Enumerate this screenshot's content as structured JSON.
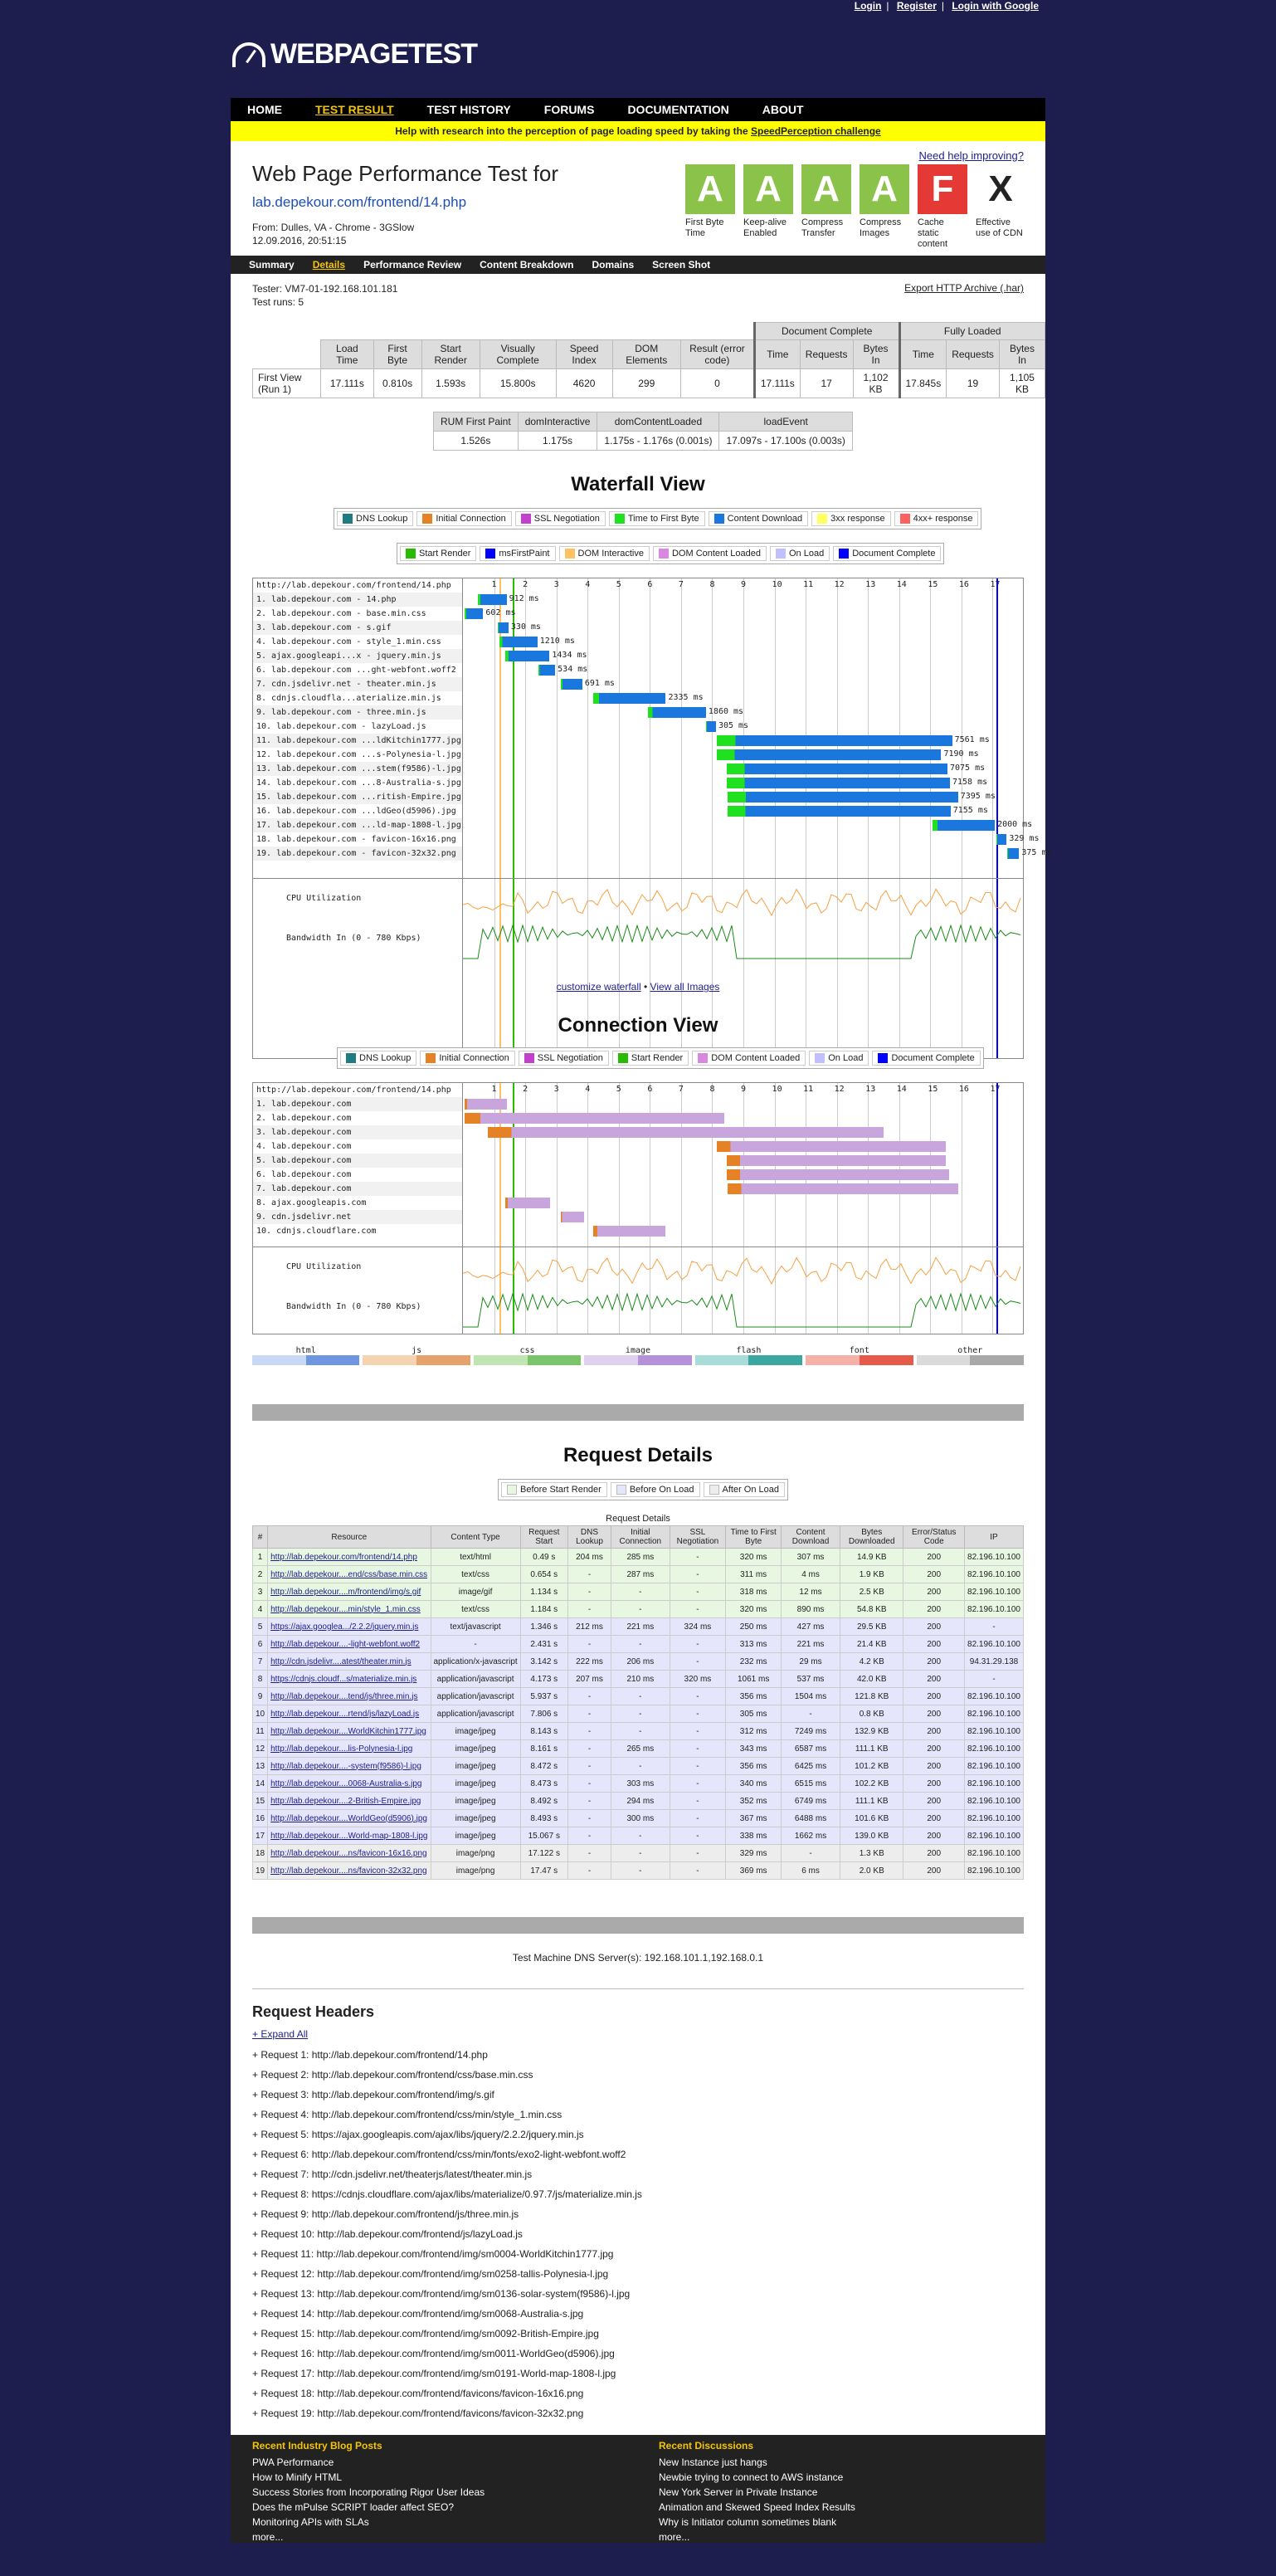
{
  "toplinks": {
    "login": "Login",
    "register": "Register",
    "google": "Login with Google"
  },
  "logo": "WEBPAGETEST",
  "nav": [
    "HOME",
    "TEST RESULT",
    "TEST HISTORY",
    "FORUMS",
    "DOCUMENTATION",
    "ABOUT"
  ],
  "banner": {
    "text": "Help with research into the perception of page loading speed by taking the",
    "link": "SpeedPerception challenge"
  },
  "help": "Need help improving?",
  "title": "Web Page Performance Test for",
  "url": "lab.depekour.com/frontend/14.php",
  "meta": {
    "from": "From: Dulles, VA - Chrome - 3GSlow",
    "date": "12.09.2016, 20:51:15"
  },
  "grades": [
    {
      "letter": "A",
      "label": "First Byte Time",
      "color": "#8bc34a"
    },
    {
      "letter": "A",
      "label": "Keep-alive Enabled",
      "color": "#8bc34a"
    },
    {
      "letter": "A",
      "label": "Compress Transfer",
      "color": "#8bc34a"
    },
    {
      "letter": "A",
      "label": "Compress Images",
      "color": "#8bc34a"
    },
    {
      "letter": "F",
      "label": "Cache static content",
      "color": "#e53935"
    },
    {
      "letter": "X",
      "label": "Effective use of CDN",
      "color": "#ffffff"
    }
  ],
  "subnav": [
    "Summary",
    "Details",
    "Performance Review",
    "Content Breakdown",
    "Domains",
    "Screen Shot"
  ],
  "tester": {
    "line1": "Tester: VM7-01-192.168.101.181",
    "line2": "Test runs: 5"
  },
  "har": "Export HTTP Archive (.har)",
  "summary": {
    "group_doc": "Document Complete",
    "group_full": "Fully Loaded",
    "headers": [
      "Load Time",
      "First Byte",
      "Start Render",
      "Visually Complete",
      "Speed Index",
      "DOM Elements",
      "Result (error code)",
      "Time",
      "Requests",
      "Bytes In",
      "Time",
      "Requests",
      "Bytes In"
    ],
    "rowlabel": "First View (Run 1)",
    "values": [
      "17.111s",
      "0.810s",
      "1.593s",
      "15.800s",
      "4620",
      "299",
      "0",
      "17.111s",
      "17",
      "1,102 KB",
      "17.845s",
      "19",
      "1,105 KB"
    ]
  },
  "rum": {
    "headers": [
      "RUM First Paint",
      "domInteractive",
      "domContentLoaded",
      "loadEvent"
    ],
    "values": [
      "1.526s",
      "1.175s",
      "1.175s - 1.176s (0.001s)",
      "17.097s - 17.100s (0.003s)"
    ]
  },
  "waterfall_title": "Waterfall View",
  "legend1": [
    {
      "label": "DNS Lookup",
      "color": "#1f7c83"
    },
    {
      "label": "Initial Connection",
      "color": "#e58226"
    },
    {
      "label": "SSL Negotiation",
      "color": "#c141cd"
    },
    {
      "label": "Time to First Byte",
      "color": "#1fe11f"
    },
    {
      "label": "Content Download",
      "color": "#1977dd"
    },
    {
      "label": "3xx response",
      "color": "#ffff60"
    },
    {
      "label": "4xx+ response",
      "color": "#ff6060"
    }
  ],
  "legend2": [
    {
      "label": "Start Render",
      "color": "#28bc00"
    },
    {
      "label": "msFirstPaint",
      "color": "#0000ff"
    },
    {
      "label": "DOM Interactive",
      "color": "#ffc061"
    },
    {
      "label": "DOM Content Loaded",
      "color": "#d888df"
    },
    {
      "label": "On Load",
      "color": "#c0c0ff"
    },
    {
      "label": "Document Complete",
      "color": "#0000ff"
    }
  ],
  "waterfall": {
    "url": "http://lab.depekour.com/frontend/14.php",
    "ticks": [
      "1",
      "2",
      "3",
      "4",
      "5",
      "6",
      "7",
      "8",
      "9",
      "10",
      "11",
      "12",
      "13",
      "14",
      "15",
      "16",
      "17"
    ],
    "rows": [
      {
        "n": "1. lab.depekour.com - 14.php",
        "s": 0.49,
        "d": 0.91,
        "t": "912 ms"
      },
      {
        "n": "2. lab.depekour.com - base.min.css",
        "s": 0.05,
        "d": 0.6,
        "t": "602 ms"
      },
      {
        "n": "3. lab.depekour.com - s.gif",
        "s": 1.13,
        "d": 0.33,
        "t": "330 ms"
      },
      {
        "n": "4. lab.depekour.com - style_1.min.css",
        "s": 1.18,
        "d": 1.21,
        "t": "1210 ms"
      },
      {
        "n": "5. ajax.googleapi...x - jquery.min.js",
        "s": 1.35,
        "d": 1.43,
        "t": "1434 ms"
      },
      {
        "n": "6. lab.depekour.com ...ght-webfont.woff2",
        "s": 2.43,
        "d": 0.53,
        "t": "534 ms"
      },
      {
        "n": "7. cdn.jsdelivr.net - theater.min.js",
        "s": 3.14,
        "d": 0.69,
        "t": "691 ms"
      },
      {
        "n": "8. cdnjs.cloudfla...aterialize.min.js",
        "s": 4.17,
        "d": 2.34,
        "t": "2335 ms"
      },
      {
        "n": "9. lab.depekour.com - three.min.js",
        "s": 5.94,
        "d": 1.86,
        "t": "1860 ms"
      },
      {
        "n": "10. lab.depekour.com - lazyLoad.js",
        "s": 7.81,
        "d": 0.31,
        "t": "305 ms"
      },
      {
        "n": "11. lab.depekour.com ...ldKitchin1777.jpg",
        "s": 8.14,
        "d": 7.56,
        "t": "7561 ms"
      },
      {
        "n": "12. lab.depekour.com ...s-Polynesia-l.jpg",
        "s": 8.16,
        "d": 7.19,
        "t": "7190 ms"
      },
      {
        "n": "13. lab.depekour.com ...stem(f9586)-l.jpg",
        "s": 8.47,
        "d": 7.08,
        "t": "7075 ms"
      },
      {
        "n": "14. lab.depekour.com ...8-Australia-s.jpg",
        "s": 8.47,
        "d": 7.16,
        "t": "7158 ms"
      },
      {
        "n": "15. lab.depekour.com ...ritish-Empire.jpg",
        "s": 8.49,
        "d": 7.4,
        "t": "7395 ms"
      },
      {
        "n": "16. lab.depekour.com ...ldGeo(d5906).jpg",
        "s": 8.49,
        "d": 7.16,
        "t": "7155 ms"
      },
      {
        "n": "17. lab.depekour.com ...ld-map-1808-l.jpg",
        "s": 15.07,
        "d": 2.0,
        "t": "2000 ms"
      },
      {
        "n": "18. lab.depekour.com - favicon-16x16.png",
        "s": 17.12,
        "d": 0.33,
        "t": "329 ms"
      },
      {
        "n": "19. lab.depekour.com - favicon-32x32.png",
        "s": 17.47,
        "d": 0.38,
        "t": "375 ms"
      }
    ],
    "cpu": "CPU Utilization",
    "bw": "Bandwidth In (0 - 780 Kbps)"
  },
  "wf_links": {
    "customize": "customize waterfall",
    "sep": " • ",
    "all": "View all Images"
  },
  "connection_title": "Connection View",
  "legend3": [
    {
      "label": "DNS Lookup",
      "color": "#1f7c83"
    },
    {
      "label": "Initial Connection",
      "color": "#e58226"
    },
    {
      "label": "SSL Negotiation",
      "color": "#c141cd"
    },
    {
      "label": "Start Render",
      "color": "#28bc00"
    },
    {
      "label": "DOM Content Loaded",
      "color": "#d888df"
    },
    {
      "label": "On Load",
      "color": "#c0c0ff"
    },
    {
      "label": "Document Complete",
      "color": "#0000ff"
    }
  ],
  "connection": {
    "rows": [
      "1. lab.depekour.com",
      "2. lab.depekour.com",
      "3. lab.depekour.com",
      "4. lab.depekour.com",
      "5. lab.depekour.com",
      "6. lab.depekour.com",
      "7. lab.depekour.com",
      "8. ajax.googleapis.com",
      "9. cdn.jsdelivr.net",
      "10. cdnjs.cloudflare.com"
    ]
  },
  "mime": [
    "html",
    "js",
    "css",
    "image",
    "flash",
    "font",
    "other"
  ],
  "req_title": "Request Details",
  "req_legend": [
    "Before Start Render",
    "Before On Load",
    "After On Load"
  ],
  "req_caption": "Request Details",
  "req_headers": [
    "#",
    "Resource",
    "Content Type",
    "Request Start",
    "DNS Lookup",
    "Initial Connection",
    "SSL Negotiation",
    "Time to First Byte",
    "Content Download",
    "Bytes Downloaded",
    "Error/Status Code",
    "IP"
  ],
  "requests": [
    [
      "1",
      "http://lab.depekour.com/frontend/14.php",
      "text/html",
      "0.49 s",
      "204 ms",
      "285 ms",
      "-",
      "320 ms",
      "307 ms",
      "14.9 KB",
      "200",
      "82.196.10.100",
      "s"
    ],
    [
      "2",
      "http://lab.depekour....end/css/base.min.css",
      "text/css",
      "0.654 s",
      "-",
      "287 ms",
      "-",
      "311 ms",
      "4 ms",
      "1.9 KB",
      "200",
      "82.196.10.100",
      "s"
    ],
    [
      "3",
      "http://lab.depekour....m/frontend/img/s.gif",
      "image/gif",
      "1.134 s",
      "-",
      "-",
      "-",
      "318 ms",
      "12 ms",
      "2.5 KB",
      "200",
      "82.196.10.100",
      "s"
    ],
    [
      "4",
      "http://lab.depekour....min/style_1.min.css",
      "text/css",
      "1.184 s",
      "-",
      "-",
      "-",
      "320 ms",
      "890 ms",
      "54.8 KB",
      "200",
      "82.196.10.100",
      "s"
    ],
    [
      "5",
      "https://ajax.googlea.../2.2.2/jquery.min.js",
      "text/javascript",
      "1.346 s",
      "212 ms",
      "221 ms",
      "324 ms",
      "250 ms",
      "427 ms",
      "29.5 KB",
      "200",
      "-",
      "o"
    ],
    [
      "6",
      "http://lab.depekour....-light-webfont.woff2",
      "-",
      "2.431 s",
      "-",
      "-",
      "-",
      "313 ms",
      "221 ms",
      "21.4 KB",
      "200",
      "82.196.10.100",
      "o"
    ],
    [
      "7",
      "http://cdn.jsdelivr....atest/theater.min.js",
      "application/x-javascript",
      "3.142 s",
      "222 ms",
      "206 ms",
      "-",
      "232 ms",
      "29 ms",
      "4.2 KB",
      "200",
      "94.31.29.138",
      "o"
    ],
    [
      "8",
      "https://cdnjs.cloudf...s/materialize.min.js",
      "application/javascript",
      "4.173 s",
      "207 ms",
      "210 ms",
      "320 ms",
      "1061 ms",
      "537 ms",
      "42.0 KB",
      "200",
      "-",
      "o"
    ],
    [
      "9",
      "http://lab.depekour....tend/js/three.min.js",
      "application/javascript",
      "5.937 s",
      "-",
      "-",
      "-",
      "356 ms",
      "1504 ms",
      "121.8 KB",
      "200",
      "82.196.10.100",
      "o"
    ],
    [
      "10",
      "http://lab.depekour....rtend/js/lazyLoad.js",
      "application/javascript",
      "7.806 s",
      "-",
      "-",
      "-",
      "305 ms",
      "-",
      "0.8 KB",
      "200",
      "82.196.10.100",
      "o"
    ],
    [
      "11",
      "http://lab.depekour....WorldKitchin1777.jpg",
      "image/jpeg",
      "8.143 s",
      "-",
      "-",
      "-",
      "312 ms",
      "7249 ms",
      "132.9 KB",
      "200",
      "82.196.10.100",
      "o"
    ],
    [
      "12",
      "http://lab.depekour....lis-Polynesia-l.jpg",
      "image/jpeg",
      "8.161 s",
      "-",
      "265 ms",
      "-",
      "343 ms",
      "6587 ms",
      "111.1 KB",
      "200",
      "82.196.10.100",
      "o"
    ],
    [
      "13",
      "http://lab.depekour....-system(f9586)-l.jpg",
      "image/jpeg",
      "8.472 s",
      "-",
      "-",
      "-",
      "356 ms",
      "6425 ms",
      "101.2 KB",
      "200",
      "82.196.10.100",
      "o"
    ],
    [
      "14",
      "http://lab.depekour....0068-Australia-s.jpg",
      "image/jpeg",
      "8.473 s",
      "-",
      "303 ms",
      "-",
      "340 ms",
      "6515 ms",
      "102.2 KB",
      "200",
      "82.196.10.100",
      "o"
    ],
    [
      "15",
      "http://lab.depekour....2-British-Empire.jpg",
      "image/jpeg",
      "8.492 s",
      "-",
      "294 ms",
      "-",
      "352 ms",
      "6749 ms",
      "111.1 KB",
      "200",
      "82.196.10.100",
      "o"
    ],
    [
      "16",
      "http://lab.depekour....WorldGeo(d5906).jpg",
      "image/jpeg",
      "8.493 s",
      "-",
      "300 ms",
      "-",
      "367 ms",
      "6488 ms",
      "101.6 KB",
      "200",
      "82.196.10.100",
      "o"
    ],
    [
      "17",
      "http://lab.depekour....World-map-1808-l.jpg",
      "image/jpeg",
      "15.067 s",
      "-",
      "-",
      "-",
      "338 ms",
      "1662 ms",
      "139.0 KB",
      "200",
      "82.196.10.100",
      "o"
    ],
    [
      "18",
      "http://lab.depekour....ns/favicon-16x16.png",
      "image/png",
      "17.122 s",
      "-",
      "-",
      "-",
      "329 ms",
      "-",
      "1.3 KB",
      "200",
      "82.196.10.100",
      "a"
    ],
    [
      "19",
      "http://lab.depekour....ns/favicon-32x32.png",
      "image/png",
      "17.47 s",
      "-",
      "-",
      "-",
      "369 ms",
      "6 ms",
      "2.0 KB",
      "200",
      "82.196.10.100",
      "a"
    ]
  ],
  "dns": "Test Machine DNS Server(s): 192.168.101.1,192.168.0.1",
  "rh_title": "Request Headers",
  "rh_expand": "+ Expand All",
  "rh_list": [
    "+ Request 1: http://lab.depekour.com/frontend/14.php",
    "+ Request 2: http://lab.depekour.com/frontend/css/base.min.css",
    "+ Request 3: http://lab.depekour.com/frontend/img/s.gif",
    "+ Request 4: http://lab.depekour.com/frontend/css/min/style_1.min.css",
    "+ Request 5: https://ajax.googleapis.com/ajax/libs/jquery/2.2.2/jquery.min.js",
    "+ Request 6: http://lab.depekour.com/frontend/css/min/fonts/exo2-light-webfont.woff2",
    "+ Request 7: http://cdn.jsdelivr.net/theaterjs/latest/theater.min.js",
    "+ Request 8: https://cdnjs.cloudflare.com/ajax/libs/materialize/0.97.7/js/materialize.min.js",
    "+ Request 9: http://lab.depekour.com/frontend/js/three.min.js",
    "+ Request 10: http://lab.depekour.com/frontend/js/lazyLoad.js",
    "+ Request 11: http://lab.depekour.com/frontend/img/sm0004-WorldKitchin1777.jpg",
    "+ Request 12: http://lab.depekour.com/frontend/img/sm0258-tallis-Polynesia-l.jpg",
    "+ Request 13: http://lab.depekour.com/frontend/img/sm0136-solar-system(f9586)-l.jpg",
    "+ Request 14: http://lab.depekour.com/frontend/img/sm0068-Australia-s.jpg",
    "+ Request 15: http://lab.depekour.com/frontend/img/sm0092-British-Empire.jpg",
    "+ Request 16: http://lab.depekour.com/frontend/img/sm0011-WorldGeo(d5906).jpg",
    "+ Request 17: http://lab.depekour.com/frontend/img/sm0191-World-map-1808-l.jpg",
    "+ Request 18: http://lab.depekour.com/frontend/favicons/favicon-16x16.png",
    "+ Request 19: http://lab.depekour.com/frontend/favicons/favicon-32x32.png"
  ],
  "footer": {
    "blog_title": "Recent Industry Blog Posts",
    "blog": [
      "PWA Performance",
      "How to Minify HTML",
      "Success Stories from Incorporating Rigor User Ideas",
      "Does the mPulse SCRIPT loader affect SEO?",
      "Monitoring APIs with SLAs",
      "more..."
    ],
    "disc_title": "Recent Discussions",
    "disc": [
      "New Instance just hangs",
      "Newbie trying to connect to AWS instance",
      "New York Server in Private Instance",
      "Animation and Skewed Speed Index Results",
      "Why is Initiator column sometimes blank",
      "more..."
    ]
  }
}
